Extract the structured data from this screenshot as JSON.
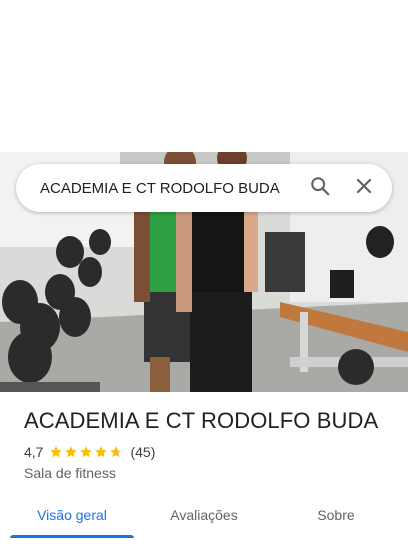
{
  "search": {
    "query": "ACADEMIA E CT RODOLFO BUDA"
  },
  "place": {
    "name": "ACADEMIA E CT RODOLFO BUDA",
    "rating": "4,7",
    "rating_value": 4.7,
    "review_count": "(45)",
    "category": "Sala de fitness"
  },
  "tabs": [
    {
      "label": "Visão geral",
      "active": true
    },
    {
      "label": "Avaliações",
      "active": false
    },
    {
      "label": "Sobre",
      "active": false
    }
  ],
  "icons": {
    "search": "search-icon",
    "close": "close-icon",
    "star": "star-icon"
  },
  "colors": {
    "accent": "#1a73e8",
    "star": "#fbbc04",
    "text": "#202124"
  }
}
